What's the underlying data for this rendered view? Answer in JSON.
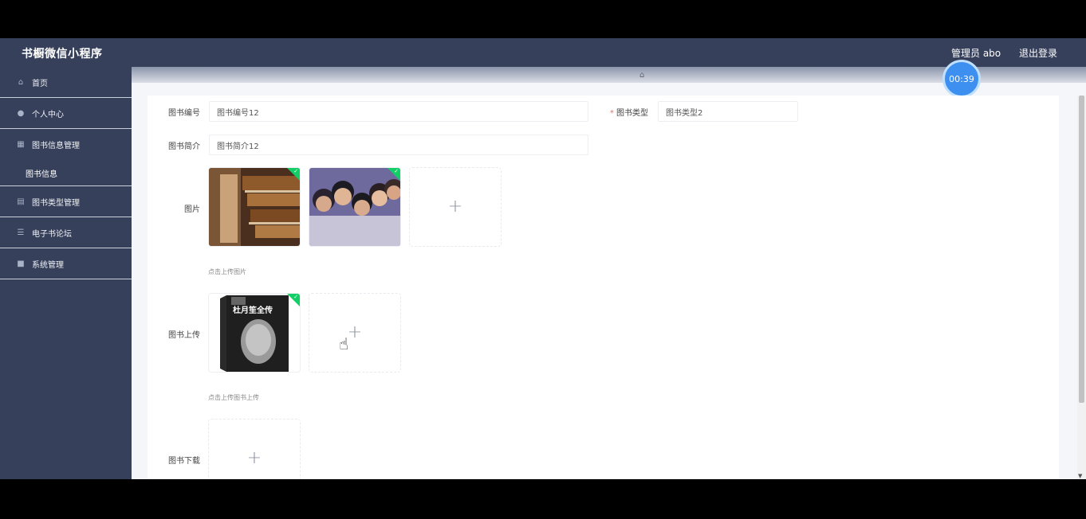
{
  "header": {
    "brand": "书橱微信小程序",
    "user_label": "管理员 abo",
    "logout_label": "退出登录"
  },
  "timer": "00:39",
  "sidebar": {
    "items": [
      {
        "label": "首页",
        "icon": "home-icon"
      },
      {
        "label": "个人中心",
        "icon": "user-icon"
      },
      {
        "label": "图书信息管理",
        "icon": "book-icon"
      },
      {
        "label": "图书信息",
        "icon": ""
      },
      {
        "label": "图书类型管理",
        "icon": "category-icon"
      },
      {
        "label": "电子书论坛",
        "icon": "forum-icon"
      },
      {
        "label": "系统管理",
        "icon": "settings-icon"
      }
    ]
  },
  "form": {
    "book_no_label": "图书编号",
    "book_no_value": "图书编号12",
    "book_type_label": "图书类型",
    "book_type_required": "*",
    "book_type_value": "图书类型2",
    "book_intro_label": "图书简介",
    "book_intro_value": "图书简介12",
    "image_label": "图片",
    "image_hint": "点击上传图片",
    "upload_label": "图书上传",
    "upload_hint": "点击上传图书上传",
    "download_label": "图书下载",
    "cover_title": "杜月笙全传"
  },
  "colors": {
    "sidebar": "#36405b",
    "accent": "#3d8ff0",
    "success": "#13ce66"
  }
}
